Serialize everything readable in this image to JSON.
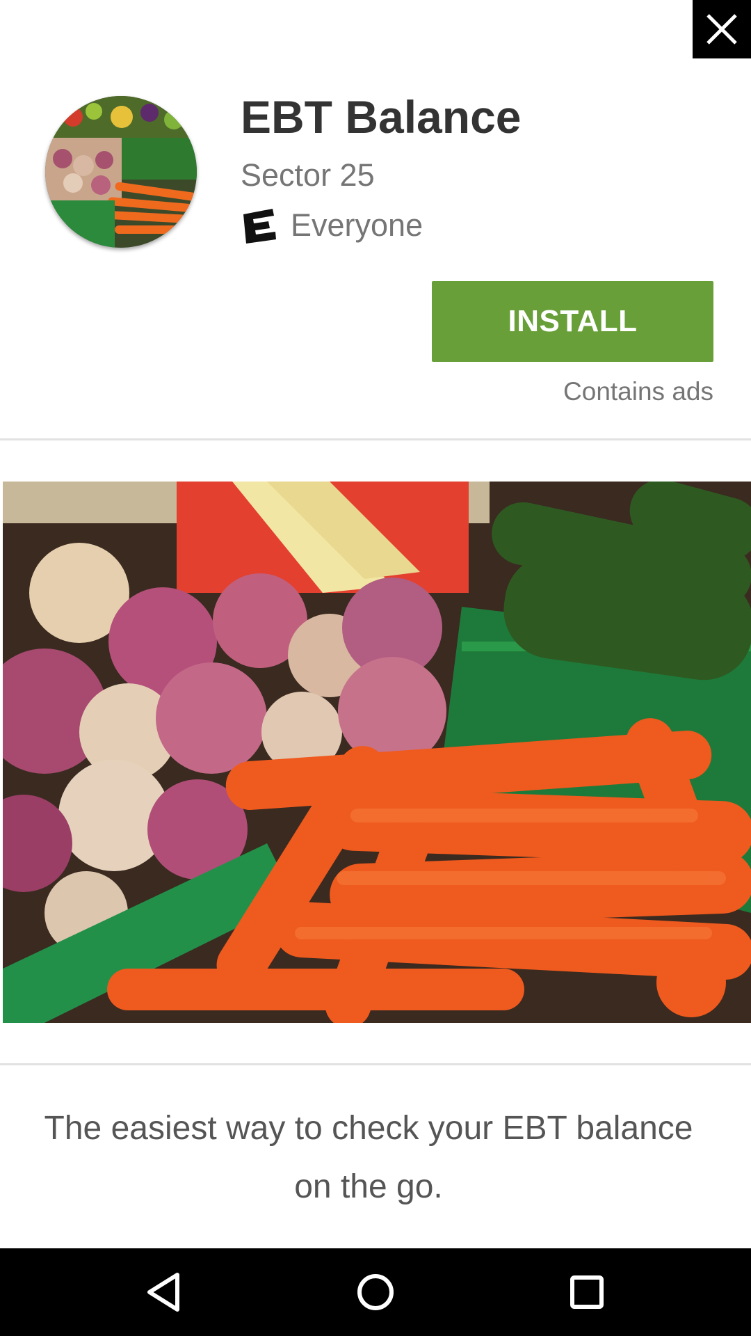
{
  "ad": {
    "close_icon": "close-icon",
    "app_name": "EBT Balance",
    "developer": "Sector 25",
    "content_rating": "Everyone",
    "content_rating_icon": "esrb-e-icon",
    "install_label": "INSTALL",
    "contains_ads": "Contains ads",
    "description": "The easiest way to check your EBT balance on the go.",
    "accent_color": "#689f38"
  },
  "navbar": {
    "back_icon": "back-triangle-icon",
    "home_icon": "home-circle-icon",
    "recents_icon": "recents-square-icon"
  }
}
